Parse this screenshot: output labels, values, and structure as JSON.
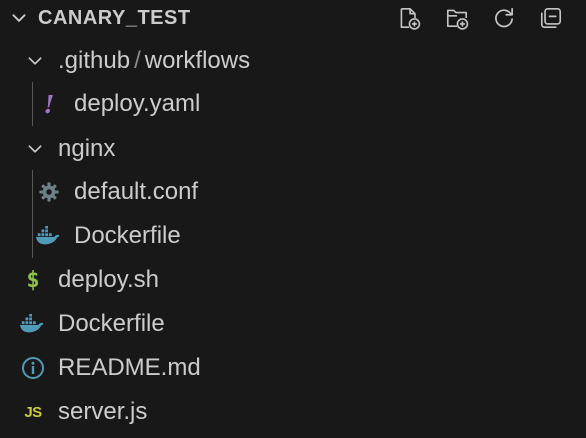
{
  "explorer": {
    "title": "CANARY_TEST",
    "actions": [
      {
        "name": "new-file-button",
        "icon": "new-file-icon"
      },
      {
        "name": "new-folder-button",
        "icon": "new-folder-icon"
      },
      {
        "name": "refresh-button",
        "icon": "refresh-icon"
      },
      {
        "name": "collapse-all-button",
        "icon": "collapse-all-icon"
      }
    ]
  },
  "tree": {
    "github_folder": {
      "label": ".github",
      "separator": "/",
      "child_label": "workflows",
      "icon": "chevron-down-icon"
    },
    "deploy_yaml": {
      "label": "deploy.yaml",
      "icon": "yaml-exclamation-icon",
      "color": "#a074c4"
    },
    "nginx_folder": {
      "label": "nginx",
      "icon": "chevron-down-icon"
    },
    "default_conf": {
      "label": "default.conf",
      "icon": "gear-icon",
      "color": "#6d8086"
    },
    "nginx_dockerfile": {
      "label": "Dockerfile",
      "icon": "docker-icon",
      "color": "#519aba"
    },
    "deploy_sh": {
      "label": "deploy.sh",
      "icon": "dollar-icon",
      "color": "#8dc149",
      "glyph": "$"
    },
    "dockerfile": {
      "label": "Dockerfile",
      "icon": "docker-icon",
      "color": "#519aba"
    },
    "readme": {
      "label": "README.md",
      "icon": "info-icon",
      "color": "#519aba"
    },
    "server_js": {
      "label": "server.js",
      "icon": "js-icon",
      "color": "#cbcb41",
      "glyph": "JS"
    }
  }
}
